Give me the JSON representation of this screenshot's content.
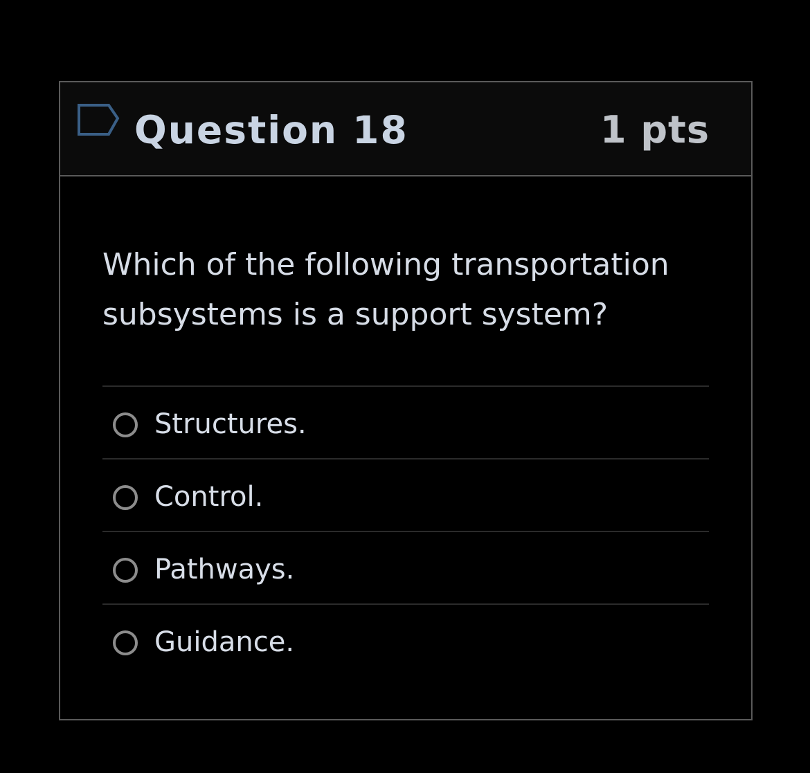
{
  "question": {
    "title": "Question 18",
    "points": "1 pts",
    "flag_icon": "flag-outline-icon",
    "text": "Which of the following transportation subsystems is a support system?"
  },
  "answers": [
    {
      "label": "Structures.",
      "selected": false
    },
    {
      "label": "Control.",
      "selected": false
    },
    {
      "label": "Pathways.",
      "selected": false
    },
    {
      "label": "Guidance.",
      "selected": false
    }
  ],
  "colors": {
    "background": "#000000",
    "header_background": "#0b0b0b",
    "border": "#5a5a5a",
    "title_text": "#c9d4e3",
    "flag_icon": "#3a5f86",
    "radio_border": "#8c8c8c"
  }
}
